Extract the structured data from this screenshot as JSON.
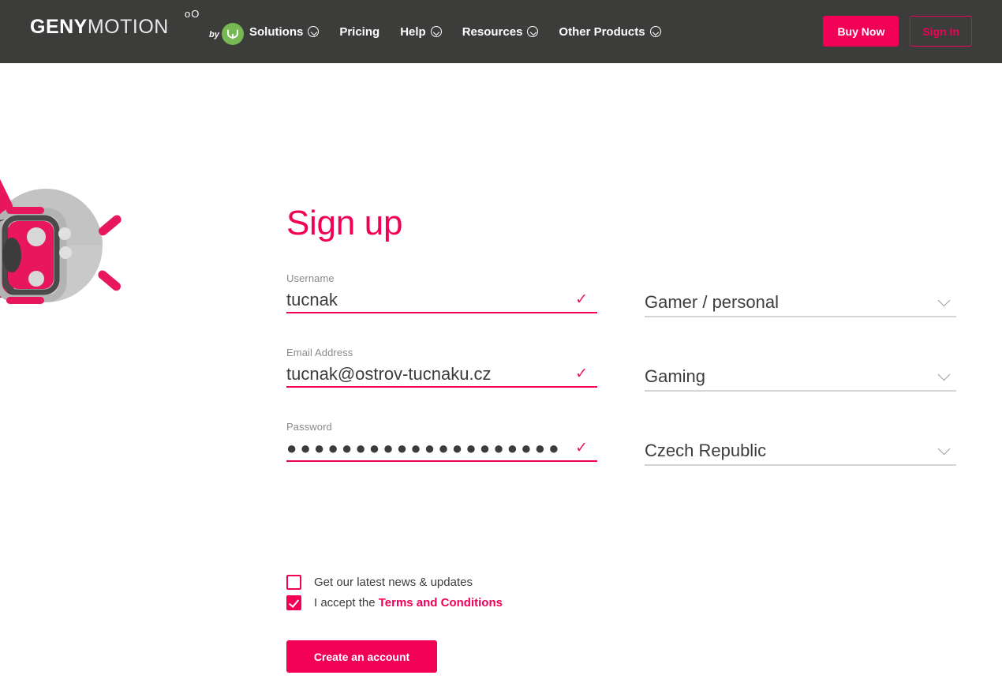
{
  "header": {
    "logo": {
      "bold_part": "GENY",
      "thin_part": "MOTION",
      "dots": "oO",
      "by_text": "by",
      "badge_icon": "genymobile-bull-logo"
    },
    "nav": [
      {
        "label": "Solutions",
        "has_dropdown": true
      },
      {
        "label": "Pricing",
        "has_dropdown": false
      },
      {
        "label": "Help",
        "has_dropdown": true
      },
      {
        "label": "Resources",
        "has_dropdown": true
      },
      {
        "label": "Other Products",
        "has_dropdown": true
      }
    ],
    "buy_label": "Buy Now",
    "signin_label": "Sign In",
    "background_color": "#3c3c3b"
  },
  "page": {
    "title": "Sign up",
    "accent_color": "#f20056",
    "decoration_icon": "genymotion-android-illustration"
  },
  "form": {
    "left_fields": [
      {
        "label": "Username",
        "value": "tucnak",
        "placeholder": "",
        "type": "text",
        "valid": true,
        "check_glyph": "✓"
      },
      {
        "label": "Email Address",
        "value": "tucnak@ostrov-tucnaku.cz",
        "placeholder": "",
        "type": "email",
        "valid": true,
        "check_glyph": "✓"
      },
      {
        "label": "Password",
        "value": "●●●●●●●●●●●●●●●●●●●●",
        "placeholder": "",
        "type": "password",
        "valid": true,
        "check_glyph": "✓"
      }
    ],
    "right_selects": [
      {
        "name": "account-type",
        "value": "Gamer / personal"
      },
      {
        "name": "industry",
        "value": "Gaming"
      },
      {
        "name": "country",
        "value": "Czech Republic"
      }
    ],
    "checkboxes": [
      {
        "name": "newsletter",
        "label": "Get our latest news & updates",
        "checked": false
      },
      {
        "name": "terms",
        "label_prefix": "I accept the ",
        "link_text": "Terms and Conditions",
        "checked": true
      }
    ],
    "submit_label": "Create an account"
  }
}
